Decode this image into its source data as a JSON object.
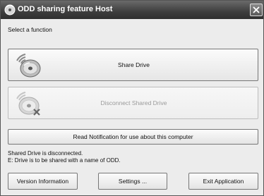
{
  "window": {
    "title": "ODD sharing feature Host",
    "close_symbol": "✕"
  },
  "prompt": "Select a function",
  "share_button": {
    "label": "Share Drive",
    "icon": "disc-wireless-icon"
  },
  "disconnect_button": {
    "label": "Disconnect Shared Drive",
    "icon": "disc-disconnect-icon",
    "enabled": false
  },
  "notification_button": {
    "label": "Read Notification for use about this computer"
  },
  "status": {
    "line1": "Shared Drive is disconnected.",
    "line2": "E: Drive is to be shared with a name of  ODD."
  },
  "footer": {
    "version_label": "Version Information",
    "settings_label": "Settings ...",
    "exit_label": "Exit Application"
  }
}
